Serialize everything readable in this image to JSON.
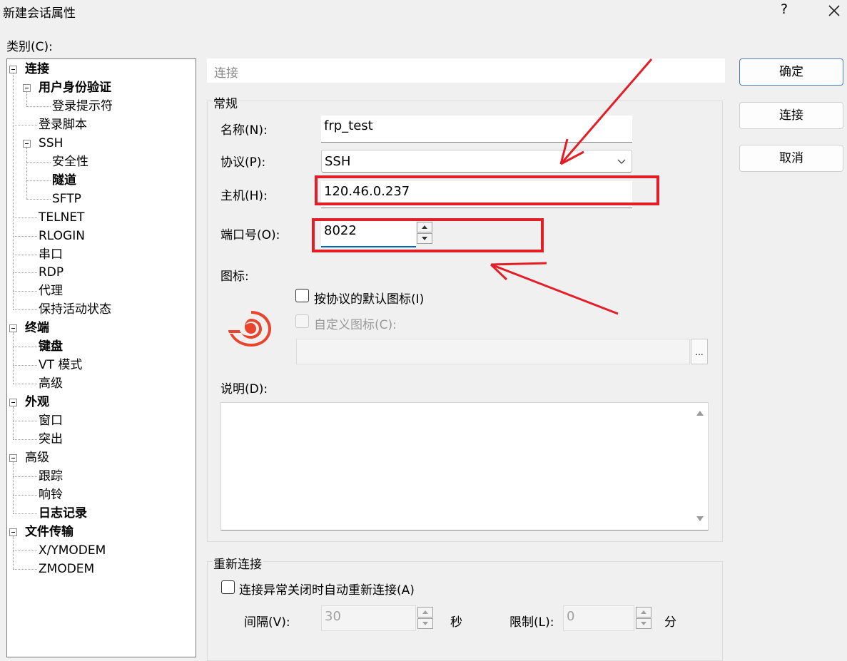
{
  "window": {
    "title": "新建会话属性",
    "help_label": "?"
  },
  "category_label": "类别(C):",
  "tree": [
    {
      "label": "连接",
      "bold": true,
      "level": 0,
      "expander": true
    },
    {
      "label": "用户身份验证",
      "bold": true,
      "level": 1,
      "expander": true
    },
    {
      "label": "登录提示符",
      "bold": false,
      "level": 2,
      "expander": false
    },
    {
      "label": "登录脚本",
      "bold": false,
      "level": 1,
      "expander": false
    },
    {
      "label": "SSH",
      "bold": false,
      "level": 1,
      "expander": true
    },
    {
      "label": "安全性",
      "bold": false,
      "level": 2,
      "expander": false
    },
    {
      "label": "隧道",
      "bold": true,
      "level": 2,
      "expander": false
    },
    {
      "label": "SFTP",
      "bold": false,
      "level": 2,
      "expander": false
    },
    {
      "label": "TELNET",
      "bold": false,
      "level": 1,
      "expander": false
    },
    {
      "label": "RLOGIN",
      "bold": false,
      "level": 1,
      "expander": false
    },
    {
      "label": "串口",
      "bold": false,
      "level": 1,
      "expander": false
    },
    {
      "label": "RDP",
      "bold": false,
      "level": 1,
      "expander": false
    },
    {
      "label": "代理",
      "bold": false,
      "level": 1,
      "expander": false
    },
    {
      "label": "保持活动状态",
      "bold": false,
      "level": 1,
      "expander": false
    },
    {
      "label": "终端",
      "bold": true,
      "level": 0,
      "expander": true
    },
    {
      "label": "键盘",
      "bold": true,
      "level": 1,
      "expander": false
    },
    {
      "label": "VT 模式",
      "bold": false,
      "level": 1,
      "expander": false
    },
    {
      "label": "高级",
      "bold": false,
      "level": 1,
      "expander": false
    },
    {
      "label": "外观",
      "bold": true,
      "level": 0,
      "expander": true
    },
    {
      "label": "窗口",
      "bold": false,
      "level": 1,
      "expander": false
    },
    {
      "label": "突出",
      "bold": false,
      "level": 1,
      "expander": false
    },
    {
      "label": "高级",
      "bold": false,
      "level": 0,
      "expander": true
    },
    {
      "label": "跟踪",
      "bold": false,
      "level": 1,
      "expander": false
    },
    {
      "label": "响铃",
      "bold": false,
      "level": 1,
      "expander": false
    },
    {
      "label": "日志记录",
      "bold": true,
      "level": 1,
      "expander": false
    },
    {
      "label": "文件传输",
      "bold": true,
      "level": 0,
      "expander": true
    },
    {
      "label": "X/YMODEM",
      "bold": false,
      "level": 1,
      "expander": false
    },
    {
      "label": "ZMODEM",
      "bold": false,
      "level": 1,
      "expander": false
    }
  ],
  "panel": {
    "header": "连接",
    "general_group": "常规",
    "name_label": "名称(N):",
    "name_value": "frp_test",
    "protocol_label": "协议(P):",
    "protocol_value": "SSH",
    "host_label": "主机(H):",
    "host_value": "120.46.0.237",
    "port_label": "端口号(O):",
    "port_value": "8022",
    "icon_label": "图标:",
    "default_icon_label": "按协议的默认图标(I)",
    "default_icon_checked": true,
    "custom_icon_label": "自定义图标(C):",
    "custom_icon_checked": false,
    "browse_label": "...",
    "desc_label": "说明(D):",
    "desc_value": "",
    "reconnect_group": "重新连接",
    "reconnect_label": "连接异常关闭时自动重新连接(A)",
    "reconnect_checked": false,
    "interval_label": "间隔(V):",
    "interval_value": "30",
    "interval_unit": "秒",
    "limit_label": "限制(L):",
    "limit_value": "0",
    "limit_unit": "分"
  },
  "buttons": {
    "ok": "确定",
    "connect": "连接",
    "cancel": "取消"
  },
  "colors": {
    "annotation": "#e41e26",
    "accent": "#0067c0",
    "logo": "#e8452c"
  }
}
